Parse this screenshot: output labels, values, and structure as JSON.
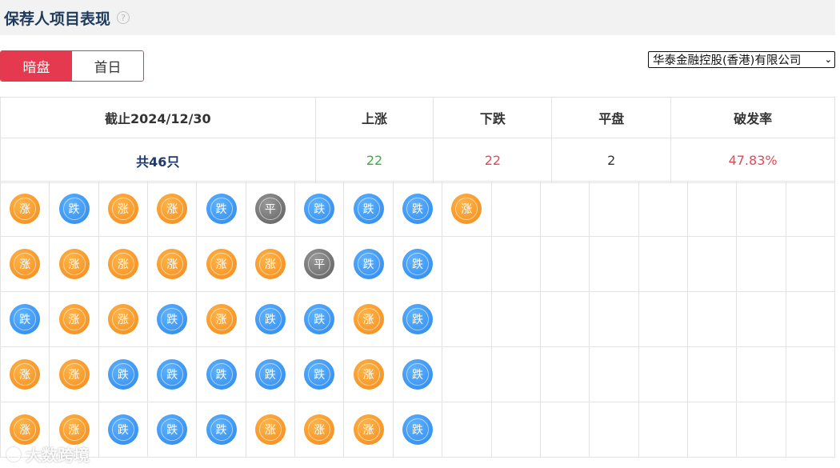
{
  "header": {
    "title": "保荐人项目表现",
    "help_icon": "question-circle-icon"
  },
  "tabs": [
    {
      "label": "暗盘",
      "active": true
    },
    {
      "label": "首日",
      "active": false
    }
  ],
  "sponsor_select": {
    "selected": "华泰金融控股(香港)有限公司"
  },
  "summary": {
    "headers": [
      "截止2024/12/30",
      "上涨",
      "下跌",
      "平盘",
      "破发率"
    ],
    "total": "共46只",
    "up": "22",
    "down": "22",
    "flat": "2",
    "rate": "47.83%"
  },
  "legend": {
    "up": "涨",
    "down": "跌",
    "flat": "平"
  },
  "grid_rows": [
    [
      "up",
      "down",
      "up",
      "up",
      "down",
      "flat",
      "down",
      "down",
      "down",
      "up"
    ],
    [
      "up",
      "up",
      "up",
      "up",
      "up",
      "up",
      "flat",
      "down",
      "down"
    ],
    [
      "down",
      "up",
      "up",
      "down",
      "up",
      "down",
      "down",
      "up",
      "down"
    ],
    [
      "up",
      "up",
      "down",
      "down",
      "down",
      "down",
      "down",
      "up",
      "down"
    ],
    [
      "up",
      "up",
      "down",
      "down",
      "down",
      "up",
      "up",
      "up",
      "down"
    ]
  ],
  "colors": {
    "accent": "#e4394f",
    "up": "#f28a1c",
    "down": "#2b86e8",
    "flat": "#666666"
  },
  "watermark": "大数跨境"
}
